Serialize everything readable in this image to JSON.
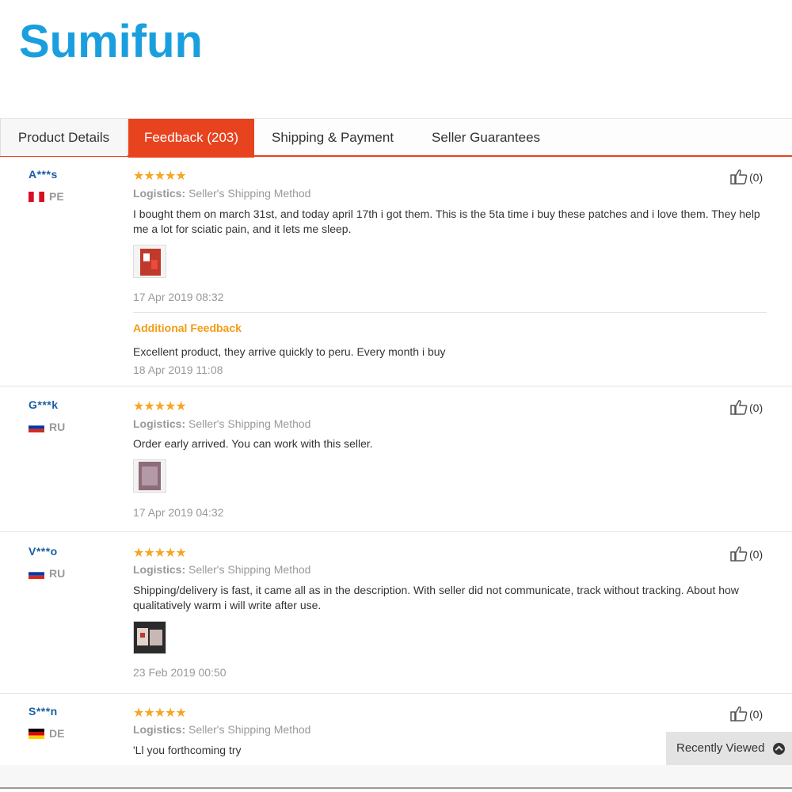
{
  "brand": {
    "logo_text": "Sumifun",
    "color": "#1a9fde"
  },
  "tabs": [
    {
      "label": "Product Details"
    },
    {
      "label": "Feedback (203)",
      "active": true
    },
    {
      "label": "Shipping & Payment"
    },
    {
      "label": "Seller Guarantees"
    }
  ],
  "colors": {
    "accent": "#e8431f",
    "star": "#f5a623",
    "additional": "#f39c12",
    "username": "#1a5ea6"
  },
  "feedback": [
    {
      "user": "A***s",
      "country": "PE",
      "stars": 5,
      "logistics_label": "Logistics:",
      "logistics_value": "Seller's Shipping Method",
      "text": "I bought them on march 31st, and today april 17th i got them. This is the 5ta time i buy these patches and i love them. They help me a lot for sciatic pain, and it lets me sleep.",
      "date": "17 Apr 2019 08:32",
      "likes": "(0)",
      "additional_title": "Additional Feedback",
      "additional_text": "Excellent product, they arrive quickly to peru. Every month i buy",
      "additional_date": "18 Apr 2019 11:08"
    },
    {
      "user": "G***k",
      "country": "RU",
      "stars": 5,
      "logistics_label": "Logistics:",
      "logistics_value": "Seller's Shipping Method",
      "text": "Order early arrived. You can work with this seller.",
      "date": "17 Apr 2019 04:32",
      "likes": "(0)"
    },
    {
      "user": "V***o",
      "country": "RU",
      "stars": 5,
      "logistics_label": "Logistics:",
      "logistics_value": "Seller's Shipping Method",
      "text": "Shipping/delivery is fast, it came all as in the description. With seller did not communicate, track without tracking. About how qualitatively warm i will write after use.",
      "date": "23 Feb 2019 00:50",
      "likes": "(0)"
    },
    {
      "user": "S***n",
      "country": "DE",
      "stars": 5,
      "logistics_label": "Logistics:",
      "logistics_value": "Seller's Shipping Method",
      "text": "'Ll you forthcoming try",
      "likes": "(0)"
    }
  ],
  "recently_viewed": "Recently Viewed",
  "icons": {
    "like": "thumbs-up-icon",
    "recent_toggle": "chevron-up-icon"
  }
}
